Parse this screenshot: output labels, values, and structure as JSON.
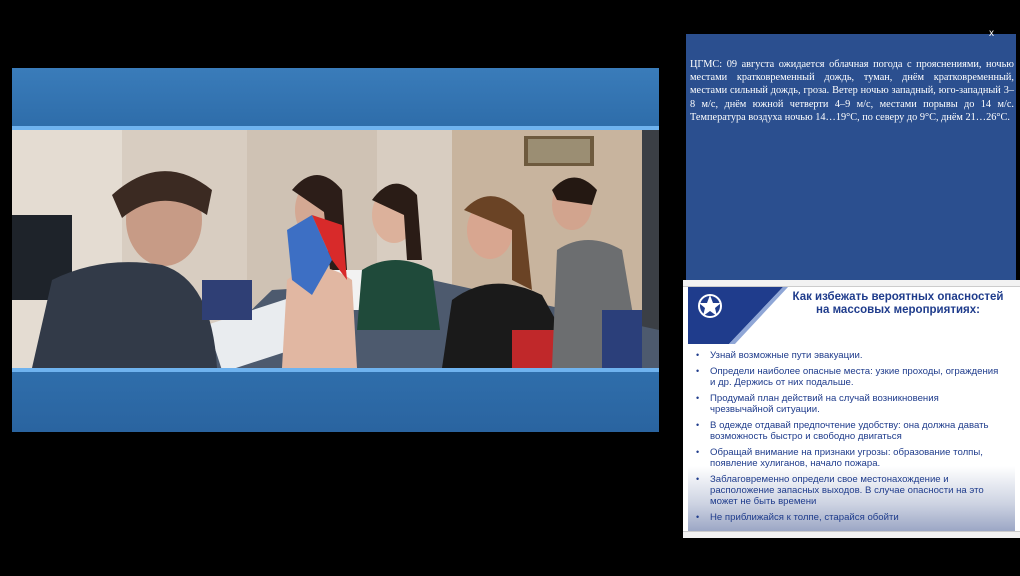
{
  "weather": {
    "text": "ЦГМС: 09 августа ожидается облачная погода с прояснениями, ночью местами кратковременный дождь, туман, днём кратковременный, местами сильный дождь, гроза. Ветер ночью западный, юго-западный 3–8 м/с, днём южной четверти 4–9 м/с, местами порывы до 14 м/с. Температура воздуха ночью 14…19°С, по северу до 9°С, днём 21…26°С.",
    "close_label": "x"
  },
  "slide": {
    "title": "Как избежать вероятных опасностей на массовых мероприятиях:",
    "bullet": "•",
    "items": [
      "Узнай возможные пути эвакуации.",
      "Определи наиболее опасные места: узкие проходы, ограждения и др. Держись от них подальше.",
      "Продумай план действий на случай возникновения чрезвычайной ситуации.",
      "В одежде отдавай предпочтение удобству: она должна давать возможность быстро и свободно двигаться",
      "Обращай внимание на признаки угрозы: образование толпы, появление хулиганов, начало пожара.",
      "Заблаговременно определи свое местонахождение и расположение запасных выходов. В случае опасности на это может не быть времени",
      "Не приближайся к толпе, старайся обойти"
    ]
  },
  "colors": {
    "video_blue": "#2d6fae",
    "video_stripe": "#6fb3ef",
    "weather_bg": "#2b4f8f",
    "slide_blue": "#1f3c8c"
  }
}
